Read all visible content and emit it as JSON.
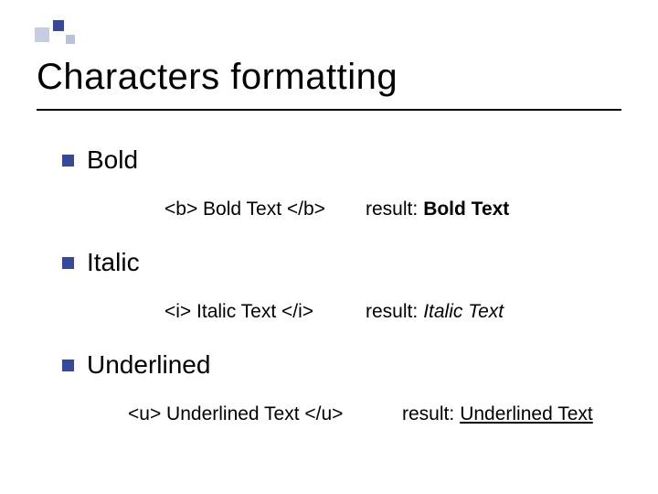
{
  "title": "Characters formatting",
  "items": [
    {
      "label": "Bold",
      "code": "<b> Bold Text </b>",
      "result_label": "result:",
      "result_value": "Bold Text",
      "style": "bold"
    },
    {
      "label": "Italic",
      "code": "<i> Italic Text </i>",
      "result_label": "result:",
      "result_value": "Italic Text",
      "style": "italic"
    },
    {
      "label": "Underlined",
      "code": "<u> Underlined Text </u>",
      "result_label": "result:",
      "result_value": "Underlined Text",
      "style": "underline"
    }
  ]
}
